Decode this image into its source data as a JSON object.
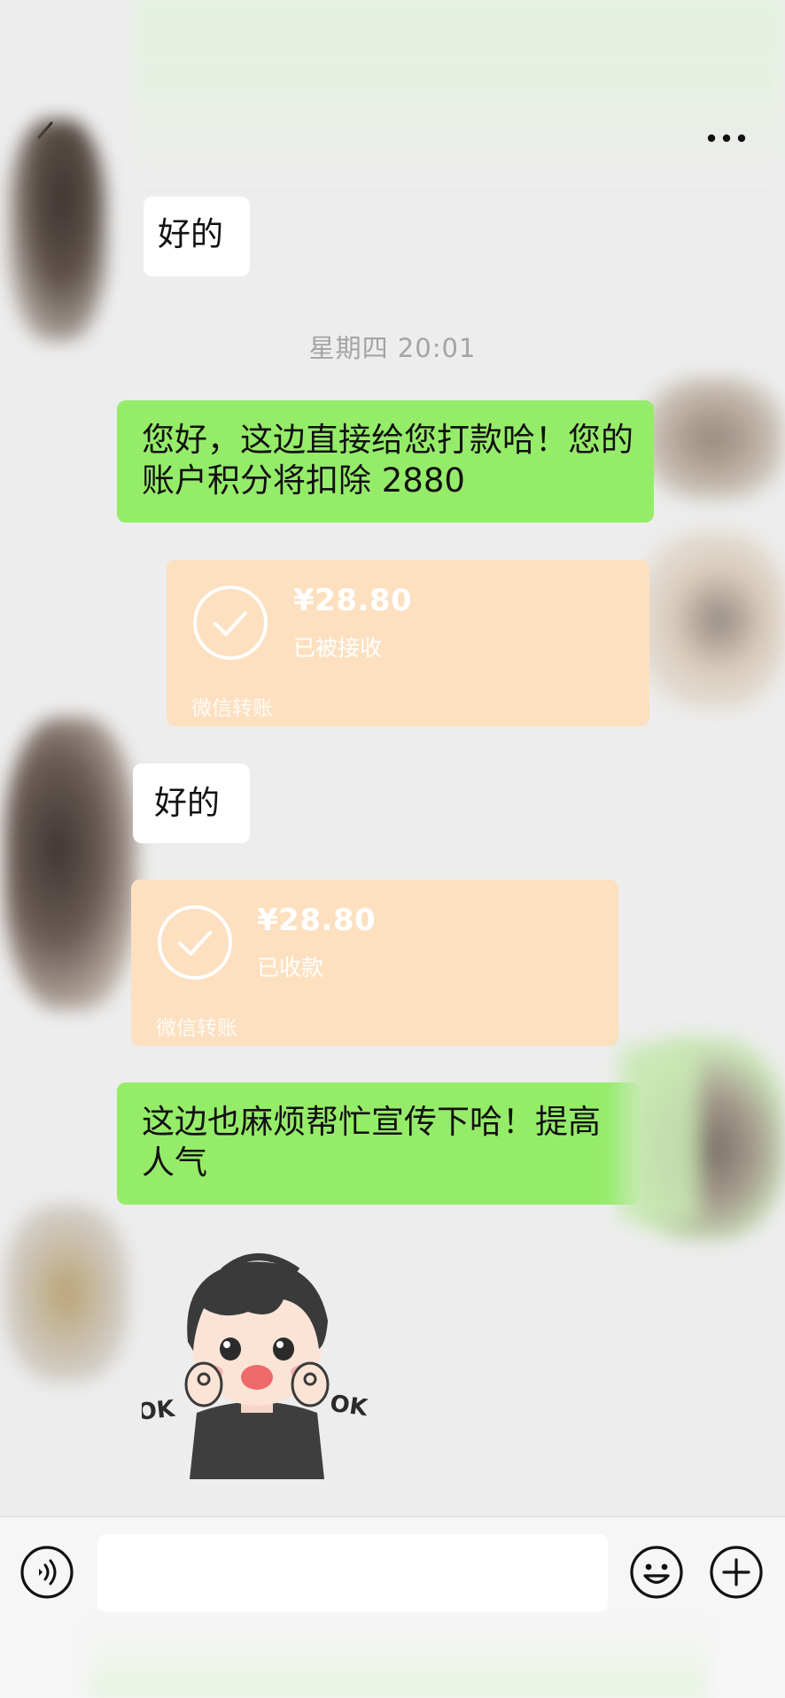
{
  "header": {
    "back_icon": "back-arrow-icon",
    "more_icon": "more-dots-icon"
  },
  "messages": {
    "m1": {
      "side": "incoming",
      "text": "好的"
    },
    "time_label": "星期四 20:01",
    "m2": {
      "side": "outgoing",
      "text": "您好，这边直接给您打款哈！您的账户积分将扣除 2880"
    },
    "transfer1": {
      "side": "outgoing",
      "amount": "¥28.80",
      "status": "已被接收",
      "footer": "微信转账"
    },
    "m3": {
      "side": "incoming",
      "text": "好的"
    },
    "transfer2": {
      "side": "incoming",
      "amount": "¥28.80",
      "status": "已收款",
      "footer": "微信转账"
    },
    "m4": {
      "side": "outgoing",
      "text": "这边也麻烦帮忙宣传下哈！提高人气"
    },
    "sticker": {
      "side": "incoming",
      "left_text": "OK",
      "right_text": "OK"
    }
  },
  "input_bar": {
    "voice_icon": "voice-icon",
    "input_value": "",
    "emoji_icon": "emoji-icon",
    "plus_icon": "plus-icon"
  },
  "colors": {
    "background": "#ededed",
    "outgoing_bubble": "#95ec69",
    "incoming_bubble": "#ffffff",
    "transfer_card": "#fde0c0",
    "time_text": "#a4a4a4"
  }
}
